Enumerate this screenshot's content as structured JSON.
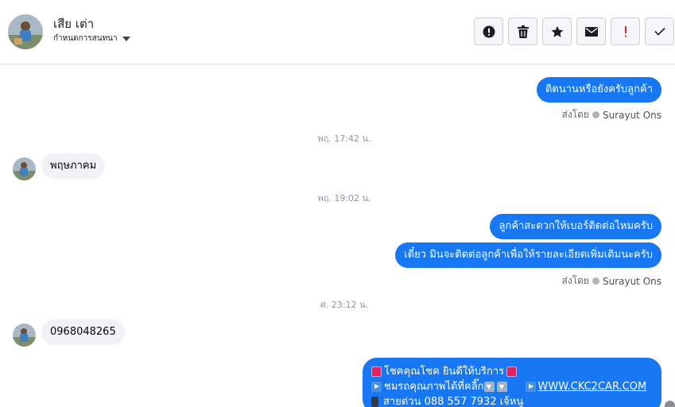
{
  "header": {
    "contact_name": "เสีย เต่า",
    "label_picker": "กำหนดการสนทนา",
    "actions": [
      {
        "name": "report",
        "icon": "alert-circle-icon"
      },
      {
        "name": "delete",
        "icon": "trash-icon"
      },
      {
        "name": "star",
        "icon": "star-icon"
      },
      {
        "name": "mark-unread",
        "icon": "envelope-icon"
      },
      {
        "name": "spam",
        "icon": "exclamation-icon"
      },
      {
        "name": "done",
        "icon": "checkmark-icon"
      }
    ]
  },
  "thread": {
    "msg1_out": "ติดนานหรือยังครับลูกค้า",
    "sent_by_label": "ส่งโดย",
    "sender_name": "Surayut Ons",
    "time1": "พฤ. 17:42 น.",
    "msg2_in": "พฤษภาคม",
    "time2": "พฤ. 19:02 น.",
    "msg3_out": "ลูกค้าสะดวกให้เบอร์ติดต่อไหมครับ",
    "msg4_out": "เดี๋ยว มินจะติดต่อลูกค้าเพื่อให้รายละเอียดเพิ่มเติมนะครับ",
    "time3": "ศ. 23:12 น.",
    "msg5_in": "0968048265",
    "promo": {
      "line1": "โชคคุณโชค ยินดีให้บริการ",
      "line2": "ชมรถคุณภาพได้ที่คลิ๊ก",
      "link": "WWW.CKC2CAR.COM",
      "line3": "สายด่วน 088 557 7932 เจ้หนู"
    }
  },
  "colors": {
    "accent": "#1877f2",
    "incoming_bubble": "#f0f2f5",
    "spam_red": "#e02424"
  }
}
